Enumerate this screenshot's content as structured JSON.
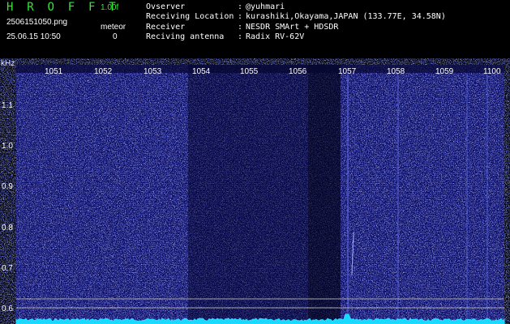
{
  "header": {
    "app_title": "H R O F F T",
    "version": "1.00f",
    "filename": "2506151050.png",
    "timestamp": "25.06.15 10:50",
    "meteor_label": "meteor",
    "meteor_count": "0"
  },
  "info": [
    {
      "key": "Ovserver",
      "sep": ":",
      "value": "@yuhmari"
    },
    {
      "key": "Receiving Location",
      "sep": ":",
      "value": "kurashiki,Okayama,JAPAN (133.77E, 34.58N)"
    },
    {
      "key": "Receiver",
      "sep": ":",
      "value": "NESDR SMArt + HDSDR"
    },
    {
      "key": "Reciving antenna",
      "sep": ":",
      "value": "Radix RV-62V"
    }
  ],
  "spectrogram": {
    "unit_label": "kHz",
    "x_tick_labels": [
      "1051",
      "1052",
      "1053",
      "1054",
      "1055",
      "1056",
      "1057",
      "1058",
      "1059",
      "1100"
    ],
    "y_tick_labels": [
      "1.1",
      "1.0",
      "0.9",
      "0.8",
      "0.7",
      "0.6"
    ],
    "colors": {
      "background": "#000000",
      "noise_dark": "#0a0a5a",
      "noise_bright": "#3a48e0",
      "signal_trace": "#22e0ff",
      "reference_lines": "#aaaaaa",
      "title_green": "#33e833"
    }
  }
}
